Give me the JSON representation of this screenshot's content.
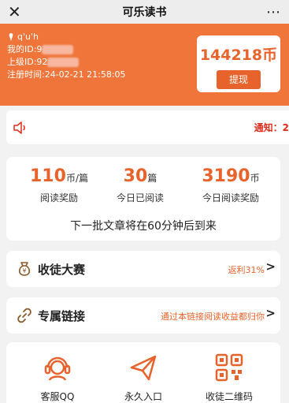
{
  "topbar": {
    "title": "可乐读书",
    "close": "✕",
    "more": "⋯"
  },
  "user": {
    "name": "q'u'h",
    "id_label": "我的ID:",
    "id_value": "9",
    "parent_label": "上级ID:",
    "parent_value": "92",
    "register_label": "注册时间:",
    "register_value": "24-02-21 21:58:05"
  },
  "balance": {
    "amount": "144218币",
    "withdraw": "提现"
  },
  "notice": {
    "icon": "speaker-icon",
    "text": "通知：2"
  },
  "stats": {
    "items": [
      {
        "value": "110",
        "unit": "币/篇",
        "label": "阅读奖励"
      },
      {
        "value": "30",
        "unit": "篇",
        "label": "今日已阅读"
      },
      {
        "value": "3190",
        "unit": "币",
        "label": "今日阅读奖励"
      }
    ],
    "tip": "下一批文章将在60分钟后到来"
  },
  "rows": [
    {
      "icon": "money-bag-icon",
      "label": "收徒大赛",
      "desc": "返利31%",
      "chev": ">"
    },
    {
      "icon": "link-icon",
      "label": "专属链接",
      "desc": "通过本链接阅读收益都归你",
      "chev": ">"
    }
  ],
  "grid": [
    {
      "icon": "customer-service-icon",
      "label": "客服QQ"
    },
    {
      "icon": "paper-plane-icon",
      "label": "永久入口"
    },
    {
      "icon": "qr-code-icon",
      "label": "收徒二维码"
    }
  ],
  "colors": {
    "brand": "#f0753a",
    "accent": "#e8632c",
    "notice": "#e02a1a"
  }
}
